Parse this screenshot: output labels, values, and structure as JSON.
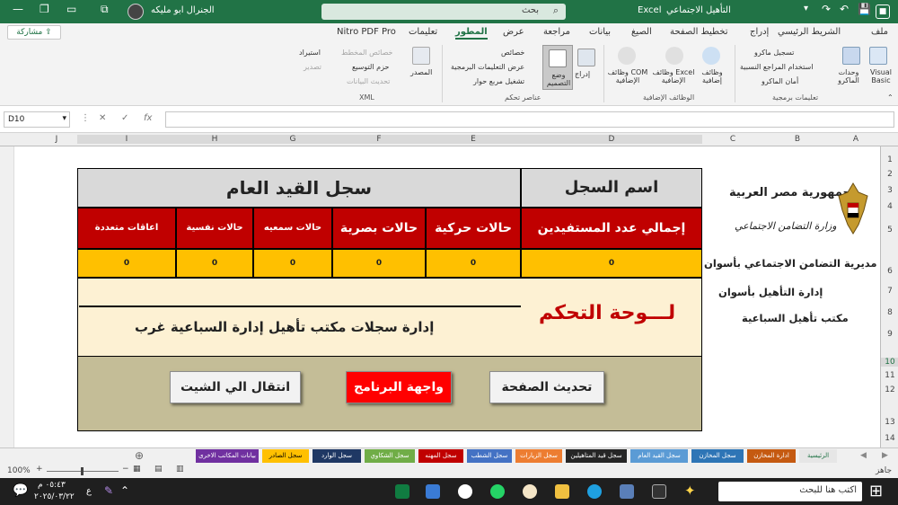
{
  "titlebar": {
    "app": "Excel",
    "file": "التأهيل الاجتماعي",
    "search": "بحث",
    "user": "الجنرال ابو مليكه"
  },
  "menu": {
    "items": [
      "ملف",
      "الشريط الرئيسي",
      "إدراج",
      "تخطيط الصفحة",
      "الصيغ",
      "بيانات",
      "مراجعة",
      "عرض",
      "المطور",
      "تعليمات",
      "Nitro PDF Pro"
    ],
    "share": "مشاركة"
  },
  "ribbon": {
    "visual_basic": "Visual Basic",
    "macros": "وحدات الماكرو",
    "record": "تسجيل ماكرو",
    "relative": "استخدام المراجع النسبية",
    "security": "أمان الماكرو",
    "code_group": "تعليمات برمجية",
    "addins": "وظائف إضافية",
    "excel_addins": "وظائف Excel الإضافية",
    "com_addins": "وظائف COM الإضافية",
    "addins_group": "الوظائف الإضافية",
    "insert": "إدراج",
    "design": "وضع التصميم",
    "properties": "خصائص",
    "view_code": "عرض التعليمات البرمجية",
    "run_dialog": "تشغيل مربع حوار",
    "controls_group": "عناصر تحكم",
    "source": "المصدر",
    "map_props": "خصائص المخطط",
    "packs": "حزم التوسيع",
    "refresh": "تحديث البيانات",
    "import": "استيراد",
    "export": "تصدير",
    "xml_group": "XML"
  },
  "formula": {
    "cell": "D10",
    "fx": "fx"
  },
  "columns": [
    "J",
    "I",
    "H",
    "G",
    "F",
    "E",
    "D",
    "C",
    "B",
    "A"
  ],
  "rows": [
    "1",
    "2",
    "3",
    "4",
    "5",
    "6",
    "7",
    "8",
    "9",
    "10",
    "11",
    "12",
    "13",
    "14"
  ],
  "sheet": {
    "header_name": "اسم السجل",
    "header_title": "سجل القيد العام",
    "categories": [
      "إجمالي عدد المستفيدين",
      "حالات حركية",
      "حالات بصرية",
      "حالات سمعيه",
      "حالات نفسية",
      "اعاقات متعددة"
    ],
    "values": [
      "0",
      "0",
      "0",
      "0",
      "0",
      "0"
    ],
    "dashboard": "لـــوحة التحكم",
    "office": "إدارة سجلات مكتب تأهيل إدارة السباعية غرب",
    "gov1": "جمهورية مصر العربية",
    "gov2": "وزارة التضامن الاجتماعي",
    "directorate": "مديرية التضامن الاجتماعي بأسوان",
    "admin": "إدارة التأهيل بأسوان",
    "office_short": "مكتب تأهيل السباعية"
  },
  "buttons": {
    "refresh": "تحديث الصفحة",
    "program": "واجهة البرنامج",
    "goto": "انتقال الي الشيت"
  },
  "tabs": [
    {
      "label": "الرئيسية",
      "color": "#e6e6e6",
      "text": "#217346"
    },
    {
      "label": "ادارة المخازن",
      "color": "#c55a11",
      "text": "#fff"
    },
    {
      "label": "سجل المخازن",
      "color": "#2e75b6",
      "text": "#fff"
    },
    {
      "label": "سجل القيد العام",
      "color": "#5b9bd5",
      "text": "#fff"
    },
    {
      "label": "سجل قيد المتاهيلين",
      "color": "#262626",
      "text": "#fff"
    },
    {
      "label": "سجل الزيارات",
      "color": "#ed7d31",
      "text": "#fff"
    },
    {
      "label": "سجل الشطب",
      "color": "#4472c4",
      "text": "#fff"
    },
    {
      "label": "سجل المهنه",
      "color": "#c00000",
      "text": "#fff"
    },
    {
      "label": "سجل الشكاوي",
      "color": "#70ad47",
      "text": "#fff"
    },
    {
      "label": "سجل الوارد",
      "color": "#1f3864",
      "text": "#fff"
    },
    {
      "label": "سجل الصادر",
      "color": "#ffc000",
      "text": "#000"
    },
    {
      "label": "بيانات المكاتب الاخرى",
      "color": "#7030a0",
      "text": "#fff"
    }
  ],
  "status": {
    "ready": "جاهز",
    "zoom": "100%"
  },
  "taskbar": {
    "search": "اكتب هنا للبحث",
    "time": "٠٥:٤٣ م",
    "date": "٢٠٢٥/٠٣/٢٢",
    "lang": "ع"
  }
}
